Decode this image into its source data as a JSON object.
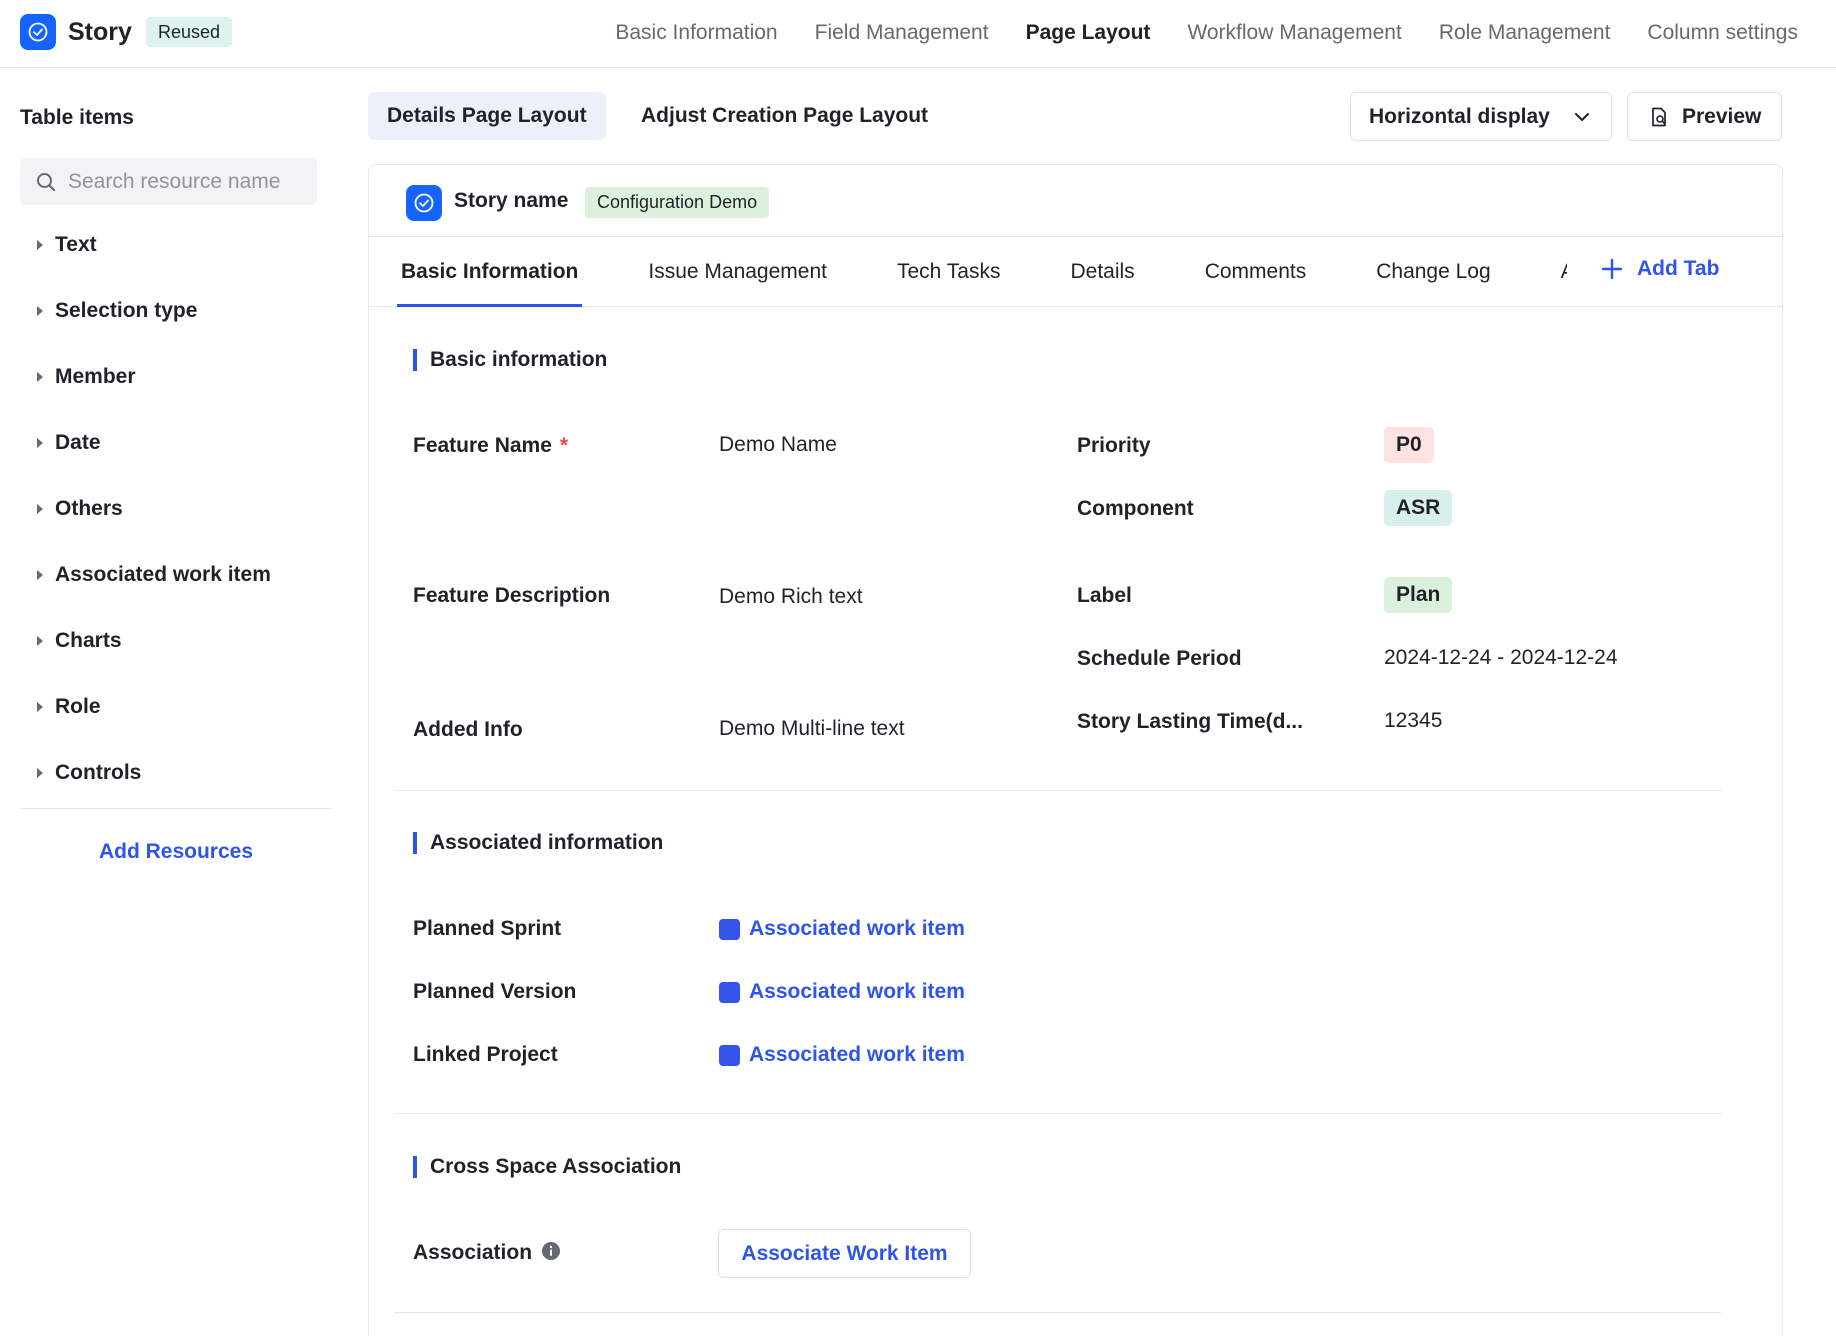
{
  "header": {
    "app_title": "Story",
    "badge": "Reused",
    "nav": [
      {
        "label": "Basic Information",
        "active": false
      },
      {
        "label": "Field Management",
        "active": false
      },
      {
        "label": "Page Layout",
        "active": true
      },
      {
        "label": "Workflow Management",
        "active": false
      },
      {
        "label": "Role Management",
        "active": false
      },
      {
        "label": "Column settings",
        "active": false
      }
    ]
  },
  "sidebar": {
    "title": "Table items",
    "search_placeholder": "Search resource name",
    "items": [
      {
        "label": "Text"
      },
      {
        "label": "Selection type"
      },
      {
        "label": "Member"
      },
      {
        "label": "Date"
      },
      {
        "label": "Others"
      },
      {
        "label": "Associated work item"
      },
      {
        "label": "Charts"
      },
      {
        "label": "Role"
      },
      {
        "label": "Controls"
      }
    ],
    "add_resources_label": "Add Resources"
  },
  "toolbar": {
    "tabs": [
      {
        "label": "Details Page Layout",
        "active": true
      },
      {
        "label": "Adjust Creation Page Layout",
        "active": false
      }
    ],
    "display_select_value": "Horizontal display",
    "preview_label": "Preview"
  },
  "card": {
    "story_name": "Story name",
    "config_badge": "Configuration Demo",
    "tabs": [
      {
        "label": "Basic Information",
        "active": true
      },
      {
        "label": "Issue Management",
        "active": false
      },
      {
        "label": "Tech Tasks",
        "active": false
      },
      {
        "label": "Details",
        "active": false
      },
      {
        "label": "Comments",
        "active": false
      },
      {
        "label": "Change Log",
        "active": false
      }
    ],
    "clipped_tab_glyph": "A",
    "add_tab_label": "Add Tab",
    "basic_section": {
      "title": "Basic information",
      "feature_name_label": "Feature Name",
      "required_mark": "*",
      "feature_name_value": "Demo Name",
      "feature_description_label": "Feature Description",
      "feature_description_value": "Demo Rich text",
      "added_info_label": "Added Info",
      "added_info_value": "Demo Multi-line text",
      "priority_label": "Priority",
      "priority_value": "P0",
      "component_label": "Component",
      "component_value": "ASR",
      "label_label": "Label",
      "label_value": "Plan",
      "schedule_label": "Schedule Period",
      "schedule_value": "2024-12-24 - 2024-12-24",
      "lasting_label": "Story Lasting Time(d...",
      "lasting_value": "12345"
    },
    "associated_section": {
      "title": "Associated information",
      "rows": [
        {
          "label": "Planned Sprint",
          "value": "Associated work item"
        },
        {
          "label": "Planned Version",
          "value": "Associated work item"
        },
        {
          "label": "Linked Project",
          "value": "Associated work item"
        }
      ]
    },
    "cross_section": {
      "title": "Cross Space Association",
      "association_label": "Association",
      "button_label": "Associate Work Item"
    }
  },
  "colors": {
    "accent": "#2f54eb",
    "brand": "#1664ff",
    "priority_bg": "#fde2e2",
    "component_bg": "#d7f0ec",
    "label_bg": "#dcf1dd"
  },
  "icons": {
    "app": "check-circle-icon",
    "search": "search-icon",
    "tree_caret": "caret-right-icon",
    "select": "chevron-down-icon",
    "preview": "preview-icon",
    "add": "plus-icon",
    "info": "info-icon"
  }
}
